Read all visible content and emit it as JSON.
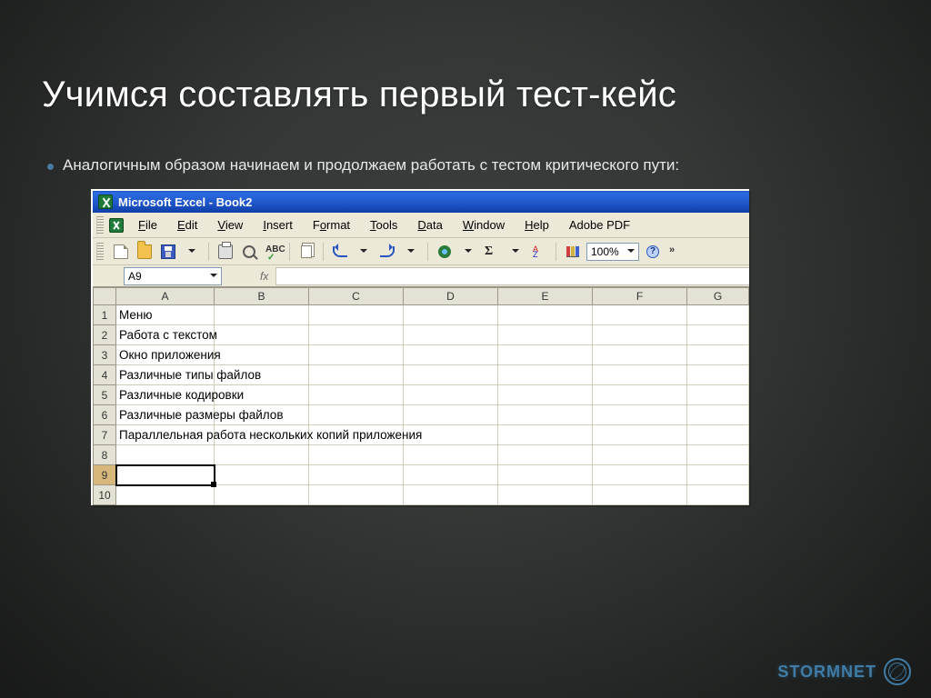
{
  "slide": {
    "title": "Учимся составлять первый тест-кейс",
    "bullet": "Аналогичным образом начинаем и продолжаем работать с тестом критического пути:"
  },
  "excel": {
    "title": "Microsoft Excel - Book2",
    "menu": [
      "File",
      "Edit",
      "View",
      "Insert",
      "Format",
      "Tools",
      "Data",
      "Window",
      "Help",
      "Adobe PDF"
    ],
    "zoom": "100%",
    "name_box": "A9",
    "fx_label": "fx",
    "columns": [
      "A",
      "B",
      "C",
      "D",
      "E",
      "F",
      "G"
    ],
    "rows": [
      "1",
      "2",
      "3",
      "4",
      "5",
      "6",
      "7",
      "8",
      "9",
      "10"
    ],
    "active_cell": "A9",
    "cells": {
      "A1": "Меню",
      "A2": "Работа с текстом",
      "A3": "Окно приложения",
      "A4": "Различные типы файлов",
      "A5": "Различные кодировки",
      "A6": "Различные размеры файлов",
      "A7": "Параллельная работа нескольких копий приложения"
    }
  },
  "brand": "STORMNET"
}
